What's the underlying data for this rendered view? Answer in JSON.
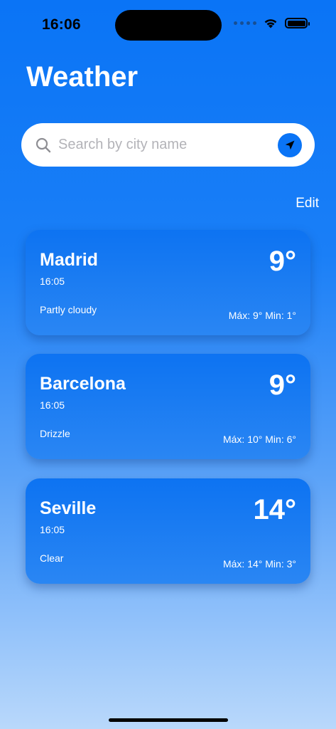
{
  "status": {
    "time": "16:06"
  },
  "header": {
    "title": "Weather"
  },
  "search": {
    "placeholder": "Search by city name",
    "value": ""
  },
  "actions": {
    "edit": "Edit"
  },
  "cities": [
    {
      "name": "Madrid",
      "time": "16:05",
      "condition": "Partly cloudy",
      "temp": "9°",
      "range": "Máx: 9° Min: 1°"
    },
    {
      "name": "Barcelona",
      "time": "16:05",
      "condition": "Drizzle",
      "temp": "9°",
      "range": "Máx: 10° Min: 6°"
    },
    {
      "name": "Seville",
      "time": "16:05",
      "condition": "Clear",
      "temp": "14°",
      "range": "Máx: 14° Min: 3°"
    }
  ],
  "colors": {
    "accent": "#0a74f6",
    "background_top": "#0a74f6",
    "background_bottom": "#b9d8fb"
  },
  "icons": {
    "search": "search-icon",
    "location": "location-arrow-icon",
    "wifi": "wifi-icon",
    "battery": "battery-icon"
  }
}
